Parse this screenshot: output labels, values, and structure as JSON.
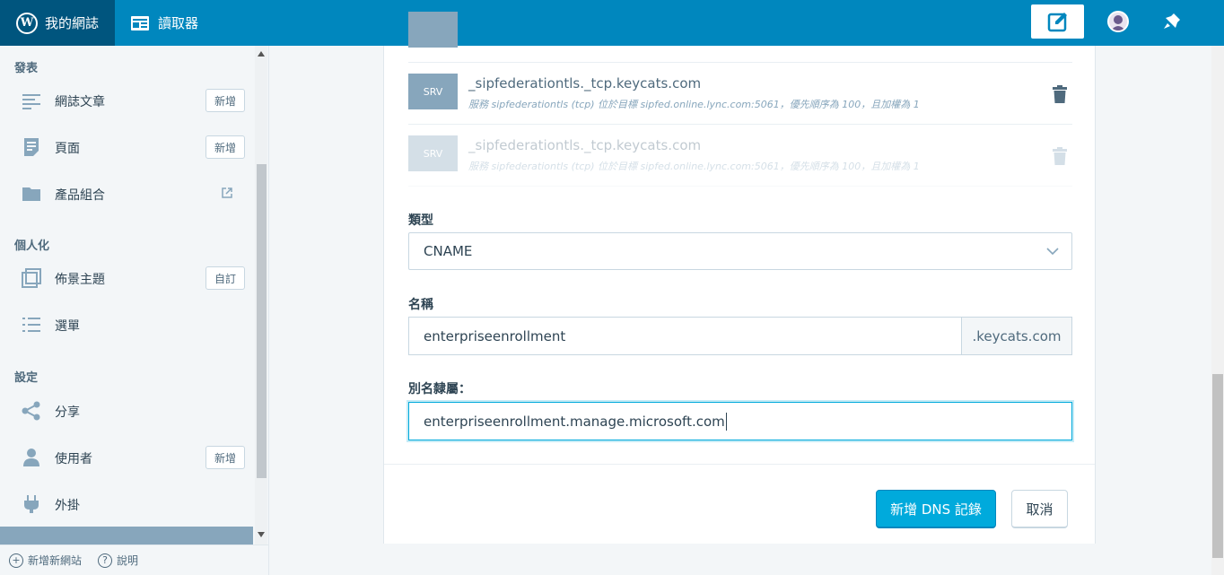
{
  "topbar": {
    "site_label": "我的網誌",
    "reader_label": "讀取器",
    "wp_letter": "W"
  },
  "sidebar": {
    "sections": {
      "publish": "發表",
      "personalize": "個人化",
      "configure": "設定"
    },
    "items": [
      {
        "label": "網誌文章",
        "badge": "新增"
      },
      {
        "label": "頁面",
        "badge": "新增"
      },
      {
        "label": "產品組合"
      },
      {
        "label": "佈景主題",
        "badge": "自訂"
      },
      {
        "label": "選單"
      },
      {
        "label": "分享"
      },
      {
        "label": "使用者",
        "badge": "新增"
      },
      {
        "label": "外掛"
      }
    ],
    "footer": {
      "add_site": "新增新網站",
      "help": "說明"
    }
  },
  "records": [
    {
      "type": "SRV",
      "name": "_sipfederationtls._tcp.keycats.com",
      "desc": "服務 sipfederationtls (tcp) 位於目標 sipfed.online.lync.com:5061，優先順序為 100，且加權為 1"
    },
    {
      "type": "SRV",
      "name": "_sipfederationtls._tcp.keycats.com",
      "desc": "服務 sipfederationtls (tcp) 位於目標 sipfed.online.lync.com:5061，優先順序為 100，且加權為 1"
    }
  ],
  "form": {
    "type_label": "類型",
    "type_value": "CNAME",
    "name_label": "名稱",
    "name_value": "enterpriseenrollment",
    "name_suffix": ".keycats.com",
    "alias_label": "別名隸屬：",
    "alias_value": "enterpriseenrollment.manage.microsoft.com",
    "submit_label": "新增 DNS 記錄",
    "cancel_label": "取消"
  },
  "colors": {
    "topbar": "#0087be",
    "topbar_dark": "#00557e",
    "primary_button": "#00aadc",
    "tag_bg": "#87a6bc"
  }
}
